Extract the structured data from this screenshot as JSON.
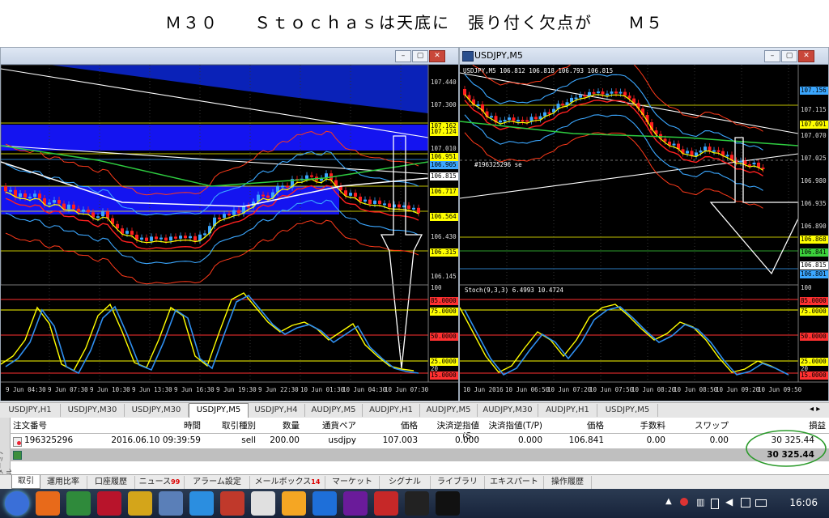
{
  "annotation_title": "Ｍ３０　　Ｓｔｏｃｈａｓは天底に　張り付く欠点が　　Ｍ５",
  "left_chart": {
    "price_labels": [
      {
        "value": "107.440",
        "color": ""
      },
      {
        "value": "107.300",
        "color": ""
      },
      {
        "value": "107.162",
        "color": "#ffff00"
      },
      {
        "value": "107.124",
        "color": "#ffff00"
      },
      {
        "value": "107.010",
        "color": ""
      },
      {
        "value": "106.951",
        "color": "#ffff00"
      },
      {
        "value": "106.905",
        "color": "#3ba7ff"
      },
      {
        "value": "106.815",
        "color": "#ffffff"
      },
      {
        "value": "106.717",
        "color": "#ffff00"
      },
      {
        "value": "106.564",
        "color": "#ffff00"
      },
      {
        "value": "106.430",
        "color": ""
      },
      {
        "value": "106.315",
        "color": "#ffff00"
      },
      {
        "value": "106.145",
        "color": ""
      }
    ],
    "stoch_labels": [
      {
        "value": "100",
        "color": ""
      },
      {
        "value": "85.0000",
        "color": "#ff3030"
      },
      {
        "value": "75.0000",
        "color": "#ffff00"
      },
      {
        "value": "50.0000",
        "color": "#ff3030"
      },
      {
        "value": "25.0000",
        "color": "#ffff00"
      },
      {
        "value": "20",
        "color": ""
      },
      {
        "value": "15.0000",
        "color": "#ff3030"
      }
    ],
    "time_labels": [
      "9 Jun 04:30",
      "9 Jun 07:30",
      "9 Jun 10:30",
      "9 Jun 13:30",
      "9 Jun 16:30",
      "9 Jun 19:30",
      "9 Jun 22:30",
      "10 Jun 01:30",
      "10 Jun 04:30",
      "10 Jun 07:30"
    ]
  },
  "right_chart": {
    "title": "USDJPY,M5",
    "info_line": "USDJPY,M5  106.812 106.818 106.793 106.815",
    "order_label": "#196325296 se",
    "stoch_title": "Stoch(9,3,3) 6.4993 10.4724",
    "price_labels": [
      {
        "value": "107.156",
        "color": "#3ba7ff"
      },
      {
        "value": "107.115",
        "color": ""
      },
      {
        "value": "107.091",
        "color": "#ffff00"
      },
      {
        "value": "107.070",
        "color": ""
      },
      {
        "value": "107.025",
        "color": ""
      },
      {
        "value": "106.980",
        "color": ""
      },
      {
        "value": "106.935",
        "color": ""
      },
      {
        "value": "106.890",
        "color": ""
      },
      {
        "value": "106.868",
        "color": "#ffff00"
      },
      {
        "value": "106.841",
        "color": "#3cd23c"
      },
      {
        "value": "106.815",
        "color": "#ffffff"
      },
      {
        "value": "106.801",
        "color": "#3ba7ff"
      }
    ],
    "stoch_labels": [
      {
        "value": "100",
        "color": ""
      },
      {
        "value": "85.0000",
        "color": "#ff3030"
      },
      {
        "value": "75.0000",
        "color": "#ffff00"
      },
      {
        "value": "50.0000",
        "color": "#ff3030"
      },
      {
        "value": "25.0000",
        "color": "#ffff00"
      },
      {
        "value": "20",
        "color": ""
      },
      {
        "value": "15.0000",
        "color": "#ff3030"
      }
    ],
    "time_labels": [
      "10 Jun 2016",
      "10 Jun 06:50",
      "10 Jun 07:20",
      "10 Jun 07:50",
      "10 Jun 08:20",
      "10 Jun 08:50",
      "10 Jun 09:20",
      "10 Jun 09:50"
    ]
  },
  "chart_tabs": [
    {
      "label": "USDJPY,H1",
      "active": false
    },
    {
      "label": "USDJPY,M30",
      "active": false
    },
    {
      "label": "USDJPY,M30",
      "active": false
    },
    {
      "label": "USDJPY,M5",
      "active": true
    },
    {
      "label": "USDJPY,H4",
      "active": false
    },
    {
      "label": "AUDJPY,M5",
      "active": false
    },
    {
      "label": "AUDJPY,H1",
      "active": false
    },
    {
      "label": "AUDJPY,M5",
      "active": false
    },
    {
      "label": "AUDJPY,M30",
      "active": false
    },
    {
      "label": "AUDJPY,H1",
      "active": false
    },
    {
      "label": "USDJPY,M5",
      "active": false
    }
  ],
  "terminal": {
    "side_label": "ターミナル",
    "headers": [
      "注文番号",
      "時間",
      "取引種別",
      "数量",
      "通貨ペア",
      "価格",
      "決済逆指値(S...",
      "決済指値(T/P)",
      "価格",
      "手数料",
      "スワップ",
      "損益"
    ],
    "order": {
      "id": "196325296",
      "time": "2016.06.10 09:39:59",
      "type": "sell",
      "volume": "200.00",
      "symbol": "usdjpy",
      "open_price": "107.003",
      "sl": "0.000",
      "tp": "0.000",
      "price": "106.841",
      "commission": "0.00",
      "swap": "0.00",
      "profit": "30 325.44"
    },
    "total_profit": "30 325.44"
  },
  "bottom_tabs": [
    {
      "label": "取引",
      "badge": "",
      "active": true
    },
    {
      "label": "運用比率",
      "badge": "",
      "active": false
    },
    {
      "label": "口座履歴",
      "badge": "",
      "active": false
    },
    {
      "label": "ニュース",
      "badge": "99",
      "active": false
    },
    {
      "label": "アラーム設定",
      "badge": "",
      "active": false
    },
    {
      "label": "メールボックス",
      "badge": "14",
      "active": false
    },
    {
      "label": "マーケット",
      "badge": "",
      "active": false
    },
    {
      "label": "シグナル",
      "badge": "",
      "active": false
    },
    {
      "label": "ライブラリ",
      "badge": "",
      "active": false
    },
    {
      "label": "エキスパート",
      "badge": "",
      "active": false
    },
    {
      "label": "操作履歴",
      "badge": "",
      "active": false
    }
  ],
  "taskbar": {
    "clock": "16:06",
    "apps": [
      "start",
      "firefox",
      "isw",
      "kaspersky",
      "app-feather",
      "app-remote",
      "internet-explorer",
      "app-trader",
      "app-chart",
      "app-q",
      "app-p",
      "app-spectrum",
      "fxdd",
      "xm",
      "terminal"
    ]
  }
}
